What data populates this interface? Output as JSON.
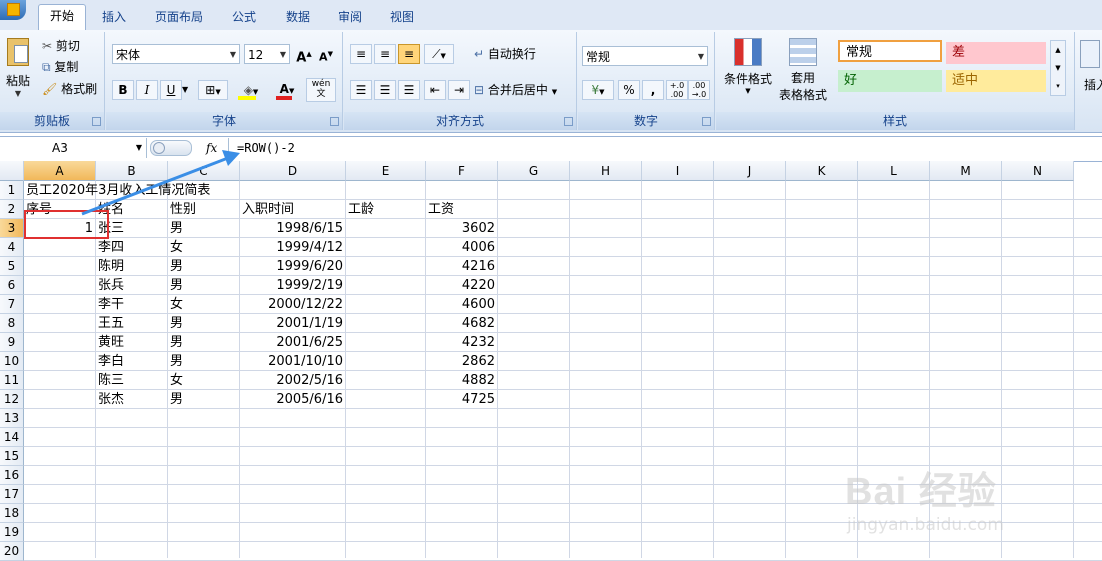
{
  "tabs": [
    "开始",
    "插入",
    "页面布局",
    "公式",
    "数据",
    "审阅",
    "视图"
  ],
  "ribbon": {
    "clipboard": {
      "paste": "粘贴",
      "cut": "剪切",
      "copy": "复制",
      "format_painter": "格式刷",
      "label": "剪贴板"
    },
    "font": {
      "name": "宋体",
      "size": "12",
      "grow": "A",
      "shrink": "A",
      "bold": "B",
      "italic": "I",
      "underline": "U",
      "label": "字体",
      "pinyin": "wén"
    },
    "alignment": {
      "wrap": "自动换行",
      "merge": "合并后居中",
      "label": "对齐方式"
    },
    "number": {
      "format": "常规",
      "percent": "%",
      "comma": ",",
      "inc_decimal": "+.0\n.00",
      "dec_decimal": ".00\n→.0",
      "label": "数字"
    },
    "styles": {
      "conditional": "条件格式",
      "table": "套用\n表格格式",
      "swatches": [
        "常规",
        "差",
        "好",
        "适中"
      ],
      "label": "样式"
    },
    "insert_partial": "插入"
  },
  "formula_bar": {
    "name_box": "A3",
    "fx": "fx",
    "formula": "=ROW()-2"
  },
  "columns": [
    "A",
    "B",
    "C",
    "D",
    "E",
    "F",
    "G",
    "H",
    "I",
    "J",
    "K",
    "L",
    "M",
    "N"
  ],
  "rows": [
    "1",
    "2",
    "3",
    "4",
    "5",
    "6",
    "7",
    "8",
    "9",
    "10",
    "11",
    "12",
    "13",
    "14",
    "15",
    "16",
    "17",
    "18",
    "19",
    "20"
  ],
  "sheet": {
    "title": "员工2020年3月收入工情况简表",
    "headers": [
      "序号",
      "姓名",
      "性别",
      "入职时间",
      "工龄",
      "工资"
    ],
    "records": [
      {
        "seq": "1",
        "name": "张三",
        "sex": "男",
        "date": "1998/6/15",
        "salary": "3602"
      },
      {
        "seq": "",
        "name": "李四",
        "sex": "女",
        "date": "1999/4/12",
        "salary": "4006"
      },
      {
        "seq": "",
        "name": "陈明",
        "sex": "男",
        "date": "1999/6/20",
        "salary": "4216"
      },
      {
        "seq": "",
        "name": "张兵",
        "sex": "男",
        "date": "1999/2/19",
        "salary": "4220"
      },
      {
        "seq": "",
        "name": "李干",
        "sex": "女",
        "date": "2000/12/22",
        "salary": "4600"
      },
      {
        "seq": "",
        "name": "王五",
        "sex": "男",
        "date": "2001/1/19",
        "salary": "4682"
      },
      {
        "seq": "",
        "name": "黄旺",
        "sex": "男",
        "date": "2001/6/25",
        "salary": "4232"
      },
      {
        "seq": "",
        "name": "李白",
        "sex": "男",
        "date": "2001/10/10",
        "salary": "2862"
      },
      {
        "seq": "",
        "name": "陈三",
        "sex": "女",
        "date": "2002/5/16",
        "salary": "4882"
      },
      {
        "seq": "",
        "name": "张杰",
        "sex": "男",
        "date": "2005/6/16",
        "salary": "4725"
      }
    ]
  },
  "watermark": {
    "brand": "Bai 经验",
    "url": "jingyan.baidu.com"
  },
  "colors": {
    "accent": "#15428b",
    "highlight": "#e03030",
    "arrow": "#3a8ee6"
  }
}
